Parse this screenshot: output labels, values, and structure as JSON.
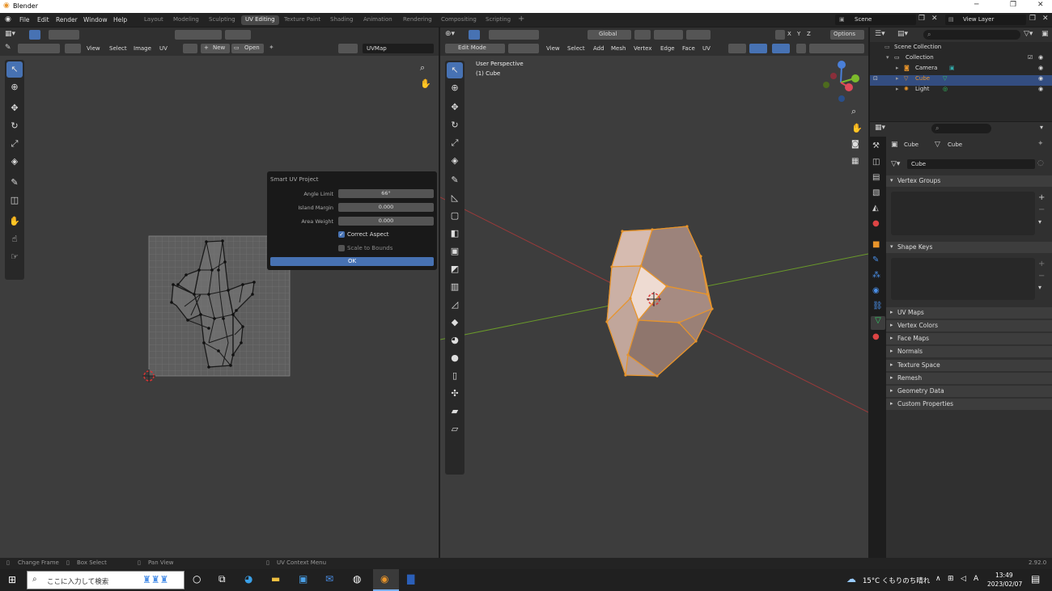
{
  "window": {
    "title": "Blender",
    "controls": [
      "─",
      "❐",
      "✕"
    ]
  },
  "menu": {
    "items": [
      "File",
      "Edit",
      "Render",
      "Window",
      "Help"
    ]
  },
  "workspaces": [
    "Layout",
    "Modeling",
    "Sculpting",
    "UV Editing",
    "Texture Paint",
    "Shading",
    "Animation",
    "Rendering",
    "Compositing",
    "Scripting"
  ],
  "scene": {
    "name": "Scene",
    "view_layer": "View Layer"
  },
  "uv_editor": {
    "menus": [
      "View",
      "Select",
      "Image",
      "UV"
    ],
    "new_label": "New",
    "open_label": "Open",
    "uvmap": "UVMap"
  },
  "popup": {
    "title": "Smart UV Project",
    "rows": [
      {
        "label": "Angle Limit",
        "value": "66°"
      },
      {
        "label": "Island Margin",
        "value": "0.000"
      },
      {
        "label": "Area Weight",
        "value": "0.000"
      }
    ],
    "correct_aspect": "Correct Aspect",
    "scale_to_bounds": "Scale to Bounds",
    "ok": "OK"
  },
  "viewport": {
    "mode": "Edit Mode",
    "menus": [
      "View",
      "Select",
      "Add",
      "Mesh",
      "Vertex",
      "Edge",
      "Face",
      "UV"
    ],
    "orientation": "Global",
    "axes": [
      "X",
      "Y",
      "Z"
    ],
    "options": "Options",
    "info_line1": "User Perspective",
    "info_line2": "(1) Cube"
  },
  "outliner": {
    "scene_collection": "Scene Collection",
    "collection": "Collection",
    "items": [
      "Camera",
      "Cube",
      "Light"
    ]
  },
  "properties": {
    "object_name": "Cube",
    "mesh_name": "Cube",
    "datablock": "Cube",
    "panels_open": [
      "Vertex Groups",
      "Shape Keys"
    ],
    "panels_closed": [
      "UV Maps",
      "Vertex Colors",
      "Face Maps",
      "Normals",
      "Texture Space",
      "Remesh",
      "Geometry Data",
      "Custom Properties"
    ]
  },
  "statusbar": {
    "items": [
      "Change Frame",
      "Box Select",
      "Pan View",
      "UV Context Menu"
    ],
    "version": "2.92.0"
  },
  "taskbar": {
    "search_placeholder": "ここに入力して検索",
    "weather": "15°C くもりのち晴れ",
    "time": "13:49",
    "date": "2023/02/07"
  },
  "colors": {
    "accent": "#4772b3",
    "selection": "#e8942a",
    "active_row": "#334d80"
  }
}
